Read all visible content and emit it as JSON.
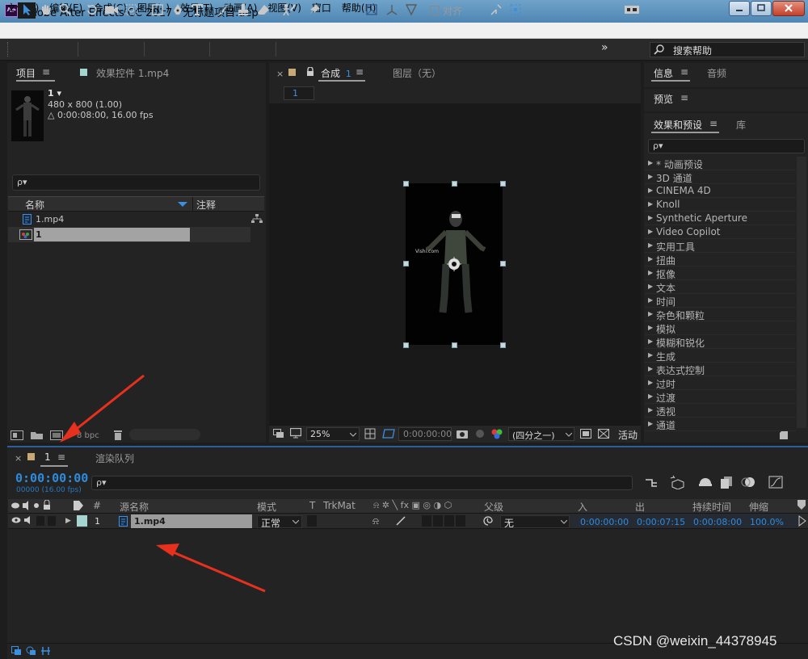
{
  "window": {
    "app_badge": "Ae",
    "title": "Adobe After Effects CC 2017 - 无标题项目.aep *"
  },
  "menu": [
    "文件(F)",
    "编辑(E)",
    "合成(C)",
    "图层(L)",
    "效果(T)",
    "动画(A)",
    "视图(V)",
    "窗口",
    "帮助(H)"
  ],
  "toolbar": {
    "snap_label": "对齐",
    "overflow": "»",
    "help_search_label": "搜索帮助"
  },
  "project": {
    "tab_project": "项目",
    "tab_effect_controls": "效果控件 1.mp4",
    "item_name": "1 ▾",
    "item_size": "480 x 800 (1.00)",
    "item_duration": "△ 0:00:08:00, 16.00 fps",
    "search_icon": "ρ▾",
    "col_name": "名称",
    "col_comment": "注释",
    "rows": [
      {
        "name": "1.mp4"
      },
      {
        "name": "1"
      }
    ],
    "bpc": "8 bpc"
  },
  "composition": {
    "tab_close": "×",
    "tab_label": "合成",
    "tab_number": "1",
    "layer_tab": "图层（无）",
    "breadcrumb": "1",
    "zoom": "25%",
    "timecode": "0:00:00:00",
    "resolution": "(四分之一)",
    "active_camera": "活动"
  },
  "right": {
    "tab_info": "信息",
    "tab_audio": "音频",
    "tab_preview": "预览",
    "tab_effects": "效果和预设",
    "tab_library": "库",
    "effects": [
      "* 动画预设",
      "3D 通道",
      "CINEMA 4D",
      "Knoll",
      "Synthetic Aperture",
      "Video Copilot",
      "实用工具",
      "扭曲",
      "抠像",
      "文本",
      "时间",
      "杂色和颗粒",
      "模拟",
      "模糊和锐化",
      "生成",
      "表达式控制",
      "过时",
      "过渡",
      "透视",
      "通道"
    ]
  },
  "timeline": {
    "tab_close": "×",
    "tab_label": "1",
    "render_queue": "渲染队列",
    "timecode": "0:00:00:00",
    "timecode_sub": "00000 (16.00 fps)",
    "columns": {
      "hash": "#",
      "source_name": "源名称",
      "mode": "模式",
      "t": "T",
      "trkmat": "TrkMat",
      "switches": "⍾ ✲ ╲ fx ▣ ◎ ◑ ⬡",
      "parent": "父级",
      "in": "入",
      "out": "出",
      "duration": "持续时间",
      "stretch": "伸缩"
    },
    "layer": {
      "index": "1",
      "name": "1.mp4",
      "mode": "正常",
      "parent": "无",
      "in": "0:00:00:00",
      "out": "0:00:07:15",
      "duration": "0:00:08:00",
      "stretch": "100.0%"
    }
  },
  "watermark": "CSDN @weixin_44378945",
  "colors": {
    "accent_blue": "#2f8bdc",
    "annotation_red": "#e8301e",
    "layer_label": "#a6d4cf"
  }
}
